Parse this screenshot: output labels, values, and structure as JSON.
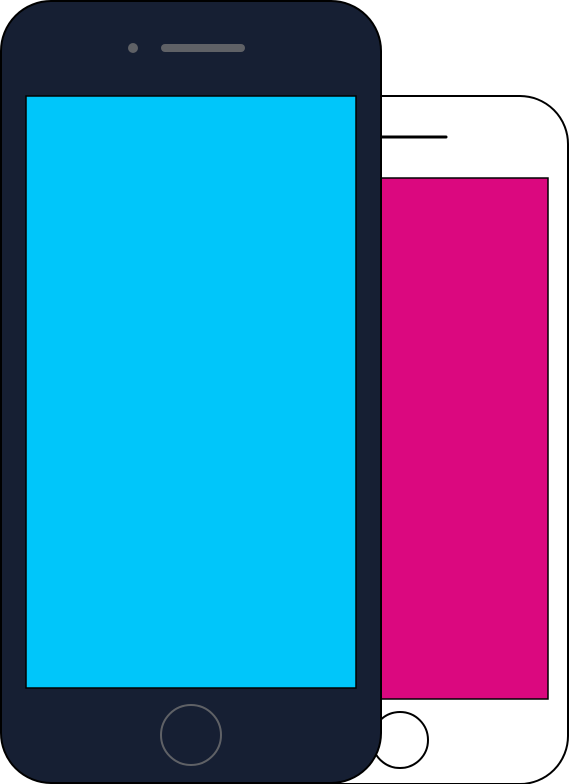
{
  "scene": {
    "background_color": "#ffffff"
  },
  "phones": {
    "back_phone": {
      "body_color": "#ffffff",
      "outline_color": "#000000",
      "screen_color": "#db087f",
      "speaker_color": "#000000",
      "home_button_fill": "#ffffff",
      "home_button_stroke": "#000000"
    },
    "front_phone": {
      "body_color": "#161f33",
      "outline_color": "#000000",
      "screen_color": "#00c6fa",
      "speaker_color": "#5f6166",
      "camera_color": "#5f6166",
      "home_button_fill": "#161f33",
      "home_button_stroke": "#5f6166"
    }
  }
}
